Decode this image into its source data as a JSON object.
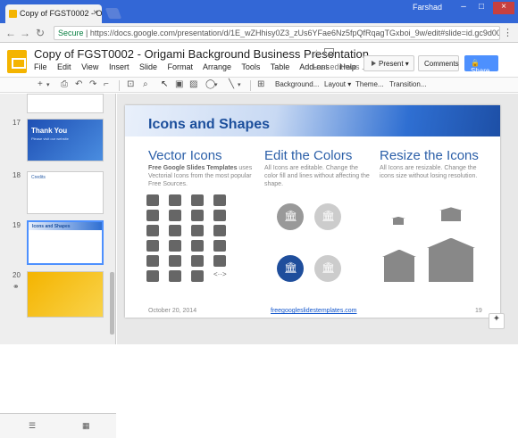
{
  "browser": {
    "tab_title": "Copy of FGST0002 - Orig",
    "tab_close": "×",
    "user": "Farshad",
    "win_min": "–",
    "win_max": "□",
    "win_close": "×",
    "back": "←",
    "forward": "→",
    "reload": "↻",
    "secure_label": "Secure",
    "url": "https://docs.google.com/presentation/d/1E_wZHhisy0Z3_zUs6YFae6Nz5fpQfRqagTGxboi_9w/edit#slide=id.gc9d00bd0...",
    "menu": "⋮"
  },
  "header": {
    "title": "Copy of FGST0002 - Origami Background Business Presentation",
    "star": "☆",
    "last_edit": "Last edit was ...",
    "present": "Present",
    "comments": "Comments",
    "share": "Share"
  },
  "menu": [
    "File",
    "Edit",
    "View",
    "Insert",
    "Slide",
    "Format",
    "Arrange",
    "Tools",
    "Table",
    "Add-ons",
    "Help"
  ],
  "toolbar": {
    "background": "Background...",
    "layout": "Layout ▾",
    "theme": "Theme...",
    "transition": "Transition..."
  },
  "filmstrip": {
    "slides": [
      {
        "num": "17",
        "title": "Thank You",
        "sub": "Please visit our website"
      },
      {
        "num": "18",
        "title": "Credits"
      },
      {
        "num": "19",
        "title": "Icons and Shapes"
      },
      {
        "num": "20",
        "title": ""
      }
    ]
  },
  "slide": {
    "title": "Icons and Shapes",
    "col1": {
      "heading": "Vector Icons",
      "bold": "Free Google Slides Templates",
      "text": " uses Vectorial Icons from the most popular Free Sources."
    },
    "col2": {
      "heading": "Edit the Colors",
      "text": "All Icons are editable. Change the color fill and lines without affecting the shape."
    },
    "col3": {
      "heading": "Resize the Icons",
      "text": "All Icons are resizable. Change the icons size without losing resolution."
    },
    "footer_date": "October 20, 2014",
    "footer_link": "freegoogleslidestemplates.com",
    "page_num": "19"
  },
  "colors": {
    "accent": "#2b5fa8",
    "circle_gray": "#999999",
    "circle_dark": "#1f4e9c",
    "share": "#4d90fe"
  }
}
